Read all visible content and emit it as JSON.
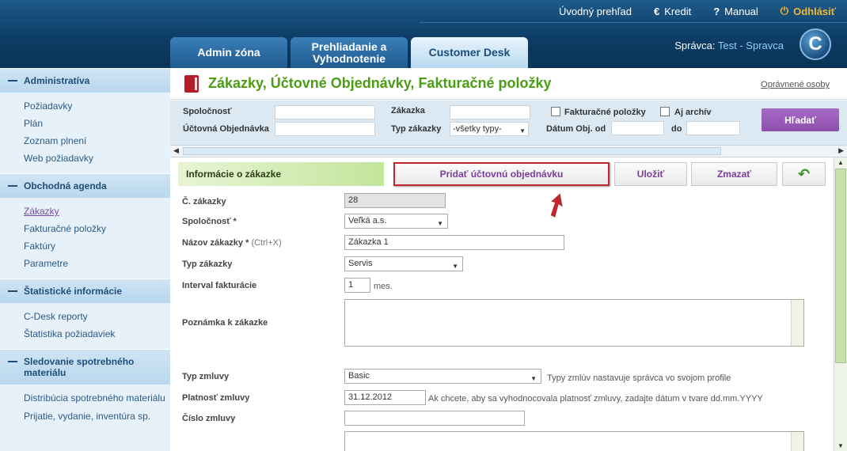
{
  "topnav": {
    "overview": "Úvodný prehľad",
    "credit": "Kredit",
    "manual": "Manual",
    "logout": "Odhlásiť"
  },
  "icons": {
    "credit": "euro-icon",
    "manual": "question-icon",
    "logout": "power-icon",
    "logo": "C"
  },
  "tabs": [
    {
      "label": "Admin zóna"
    },
    {
      "label": "Prehliadanie a Vyhodnotenie"
    },
    {
      "label": "Customer Desk"
    }
  ],
  "manager": {
    "prefix": "Správca:",
    "name": "Test - Spravca"
  },
  "sidebar": {
    "sections": [
      {
        "title": "Administratíva",
        "items": [
          "Požiadavky",
          "Plán",
          "Zoznam plnení",
          "Web požiadavky"
        ]
      },
      {
        "title": "Obchodná agenda",
        "items": [
          "Zákazky",
          "Fakturačné položky",
          "Faktúry",
          "Parametre"
        ]
      },
      {
        "title": "Štatistické informácie",
        "items": [
          "C-Desk reporty",
          "Štatistika požiadaviek"
        ]
      },
      {
        "title": "Sledovanie spotrebného materiálu",
        "items": [
          "Distribúcia spotrebného materiálu",
          "Prijatie, vydanie, inventúra sp."
        ]
      }
    ],
    "active_item": "Zákazky"
  },
  "page": {
    "title": "Zákazky, Účtovné Objednávky, Fakturačné položky",
    "auth_link": "Oprávnené osoby"
  },
  "filters": {
    "company_label": "Spoločnosť",
    "order_acc_label": "Účtovná Objednávka",
    "contract_label": "Zákazka",
    "type_label": "Typ zákazky",
    "type_value": "-všetky typy-",
    "invoice_items_label": "Fakturačné položky",
    "archive_label": "Aj archív",
    "date_from_label": "Dátum Obj. od",
    "date_to_label": "do",
    "search_button": "Hľadať"
  },
  "actions": {
    "info_heading": "Informácie o zákazke",
    "add_order": "Pridať účtovnú objednávku",
    "save": "Uložiť",
    "delete": "Zmazať",
    "back_symbol": "↶"
  },
  "form": {
    "number_label": "Č. zákazky",
    "number_value": "28",
    "company_label": "Spoločnosť *",
    "company_value": "Veľká a.s.",
    "name_label": "Názov zákazky *",
    "name_hint": "(Ctrl+X)",
    "name_value": "Zákazka 1",
    "type_label": "Typ zákazky",
    "type_value": "Servis",
    "interval_label": "Interval fakturácie",
    "interval_value": "1",
    "interval_unit": "mes.",
    "note_label": "Poznámka k zákazke",
    "contract_type_label": "Typ zmluvy",
    "contract_type_value": "Basic",
    "contract_type_hint": "Typy zmlúv nastavuje správca vo svojom profile",
    "validity_label": "Platnosť zmluvy",
    "validity_value": "31.12.2012",
    "validity_hint": "Ak chcete, aby sa vyhodnocovala platnosť zmluvy, zadajte dátum v tvare dd.mm.YYYY",
    "contract_number_label": "Číslo zmluvy"
  },
  "colors": {
    "accent_green": "#4a9e12",
    "header_blue": "#0c3b63",
    "purple": "#8c4fae",
    "highlight_red": "#c0272d"
  }
}
